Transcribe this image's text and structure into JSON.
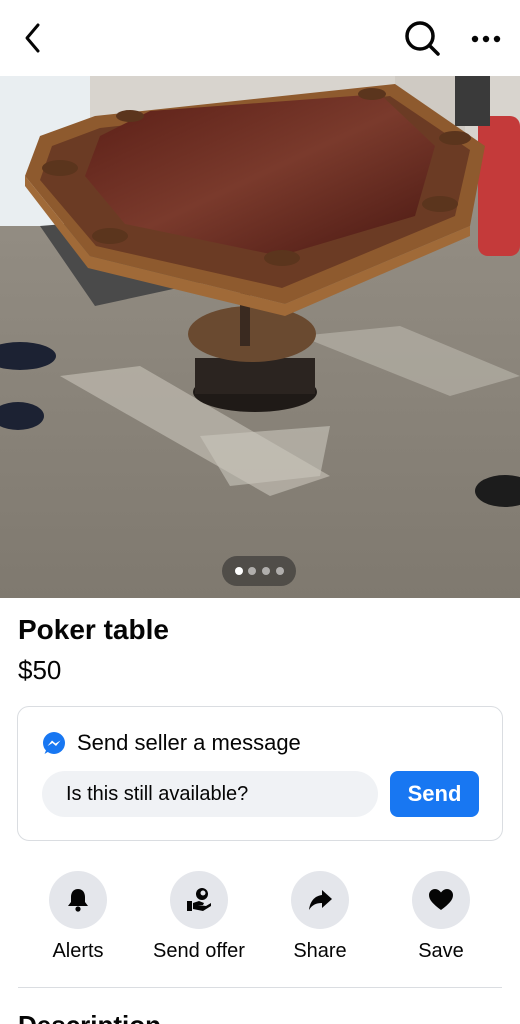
{
  "topbar": {
    "back_icon": "chevron-left-icon",
    "search_icon": "search-icon",
    "more_icon": "more-icon"
  },
  "listing": {
    "photo_count": 4,
    "current_photo": 1,
    "title": "Poker table",
    "price": "$50"
  },
  "message": {
    "title": "Send seller a message",
    "input_value": "Is this still available?",
    "send_label": "Send",
    "icon": "messenger-icon"
  },
  "actions": [
    {
      "label": "Alerts",
      "icon": "bell-icon"
    },
    {
      "label": "Send offer",
      "icon": "offer-icon"
    },
    {
      "label": "Share",
      "icon": "share-icon"
    },
    {
      "label": "Save",
      "icon": "heart-icon"
    }
  ],
  "description_heading": "Description",
  "colors": {
    "accent": "#1877f2",
    "circle_bg": "#e4e6eb",
    "input_bg": "#f0f2f5"
  }
}
